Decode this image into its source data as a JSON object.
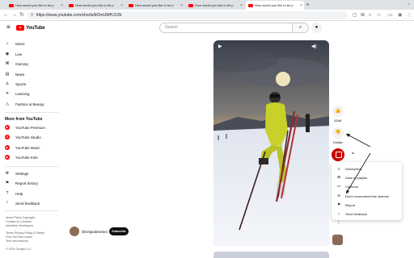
{
  "browser": {
    "tabs": [
      {
        "title": "How would you like to be p",
        "active": false
      },
      {
        "title": "How would you like to be p",
        "active": false
      },
      {
        "title": "How would you like to be p",
        "active": false
      },
      {
        "title": "How would you like to be p",
        "active": false
      },
      {
        "title": "How would you like to be p",
        "active": true
      }
    ],
    "new_tab": "+",
    "url": "https://www.youtube.com/shorts/bOmUWHJ1Xk"
  },
  "header": {
    "logo_text": "YouTube",
    "search_placeholder": "Search"
  },
  "sidebar": {
    "top_items": [
      {
        "label": "Music",
        "icon": "music-icon"
      },
      {
        "label": "Live",
        "icon": "live-icon"
      },
      {
        "label": "Gaming",
        "icon": "gaming-icon"
      },
      {
        "label": "News",
        "icon": "news-icon"
      },
      {
        "label": "Sports",
        "icon": "sports-icon"
      },
      {
        "label": "Learning",
        "icon": "learning-icon"
      },
      {
        "label": "Fashion & Beauty",
        "icon": "hanger-icon"
      }
    ],
    "more_heading": "More from YouTube",
    "more_items": [
      {
        "label": "YouTube Premium"
      },
      {
        "label": "YouTube Studio"
      },
      {
        "label": "YouTube Music"
      },
      {
        "label": "YouTube Kids"
      }
    ],
    "bottom_items": [
      {
        "label": "Settings",
        "icon": "gear-icon"
      },
      {
        "label": "Report history",
        "icon": "flag-icon"
      },
      {
        "label": "Help",
        "icon": "help-icon"
      },
      {
        "label": "Send feedback",
        "icon": "feedback-icon"
      }
    ],
    "footer": [
      "About  Press  Copyright",
      "Contact us  Creators",
      "Advertise  Developers",
      "Terms  Privacy  Policy & Safety",
      "How YouTube works",
      "Test new features",
      "© 2024 Google LLC"
    ]
  },
  "channel": {
    "handle": "@sergiodeserani",
    "subscribe_label": "Subscribe"
  },
  "actions": {
    "likes": "526K",
    "dislike_label": "Dislike",
    "eq": "="
  },
  "context_menu": {
    "items": [
      {
        "label": "Description",
        "icon": "description-icon"
      },
      {
        "label": "Save to playlist",
        "icon": "playlist-add-icon"
      },
      {
        "label": "Captions",
        "icon": "captions-icon"
      },
      {
        "label": "Don't recommend this channel",
        "icon": "block-icon"
      },
      {
        "label": "Report",
        "icon": "flag-icon"
      },
      {
        "label": "Send feedback",
        "icon": "feedback-icon"
      }
    ]
  },
  "colors": {
    "brand_red": "#ff0000",
    "report_red": "#cc0000"
  }
}
